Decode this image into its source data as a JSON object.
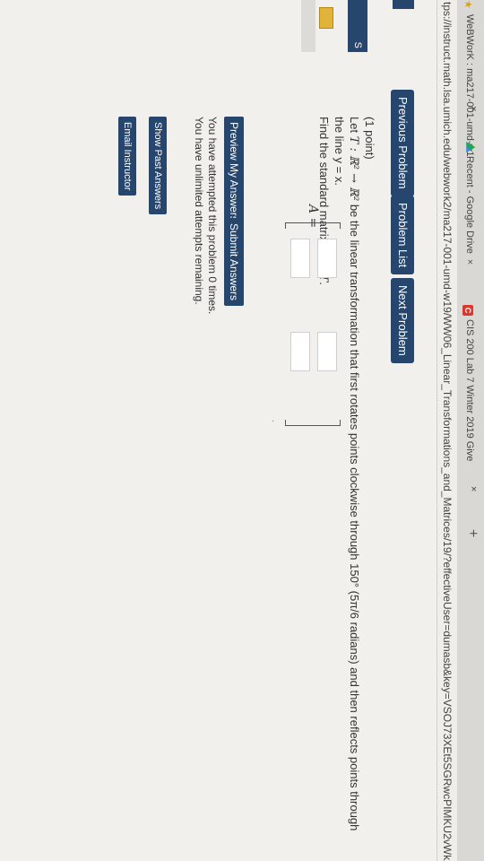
{
  "browser": {
    "tabs": [
      {
        "label": "WeBWorK : ma217-001-umd-w1",
        "close": "×"
      },
      {
        "label": "Recent - Google Drive",
        "close": "×"
      },
      {
        "label": "CIS 200 Lab 7 Winter 2019 Give",
        "close": "×",
        "badge": "C"
      }
    ],
    "new_tab": "+",
    "url": "tps://instruct.math.lsa.umich.edu/webwork2/ma217-001-umd-w19/WW06_Linear_Transformations_and_Matrices/19/?effectiveUser=dumasb&key=VSOJ73XEt5SGRwcPIMKU2vWkzyx"
  },
  "sidebar": {
    "label": "S"
  },
  "nav": {
    "prev": "Previous Problem",
    "list": "Problem List",
    "next": "Next Problem"
  },
  "problem": {
    "points": "(1 point)",
    "statement_prefix": "Let ",
    "statement_math": "T : ℝ² → ℝ²",
    "statement_rest": " be the linear transformation that first rotates points clockwise through 150° (5π/6 radians) and then reflects points through the line y = x.",
    "find_text": "Find the standard matrix ",
    "find_math": "A",
    "find_tail": " for ",
    "find_T": "T",
    "find_end": ".",
    "matrix_label": "A =",
    "matrix_dot": "."
  },
  "answers": {
    "preview": "Preview My Answers",
    "submit": "Submit Answers",
    "attempted": "You have attempted this problem 0 times.",
    "remaining": "You have unlimited attempts remaining.",
    "past": "Show Past Answers",
    "email": "Email Instructor"
  },
  "colors": {
    "button": "#26466d",
    "accent": "#e2b33a"
  }
}
